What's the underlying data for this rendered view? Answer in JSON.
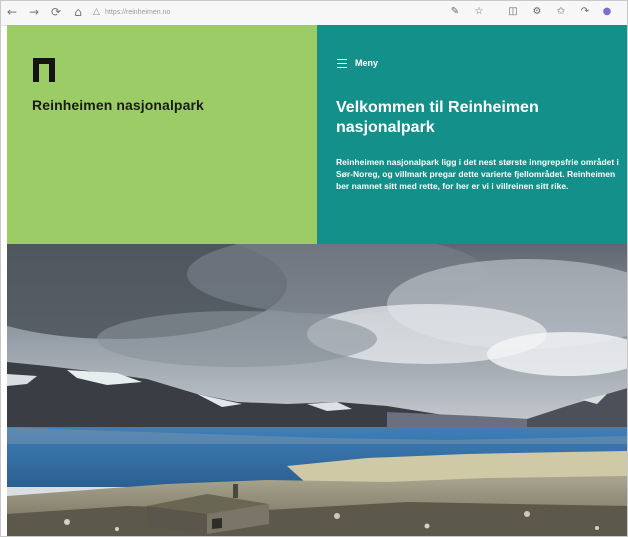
{
  "browser": {
    "url": "https://reinheimen.no",
    "icons": [
      "back-arrow-icon",
      "forward-arrow-icon",
      "refresh-icon",
      "home-icon",
      "lock-icon",
      "reader-icon",
      "favorite-star-icon",
      "collections-icon",
      "extensions-icon",
      "favorites-icon",
      "share-icon",
      "profile-icon"
    ]
  },
  "header": {
    "park_name": "Reinheimen nasjonalpark",
    "menu_label": "Meny",
    "headline": "Velkommen til Reinheimen nasjonalpark",
    "intro": "Reinheimen nasjonalpark ligg i det nest største inngrepsfrie området i Sør-Noreg, og villmark pregar dette varierte fjellområdet. Reinheimen ber namnet sitt med rette, for her er vi i villreinen sitt rike."
  },
  "colors": {
    "green_panel": "#9ccc65",
    "teal_panel": "#13908a",
    "logo": "#141414"
  },
  "hero_image": {
    "subject": "mountain-lake-cabin"
  }
}
